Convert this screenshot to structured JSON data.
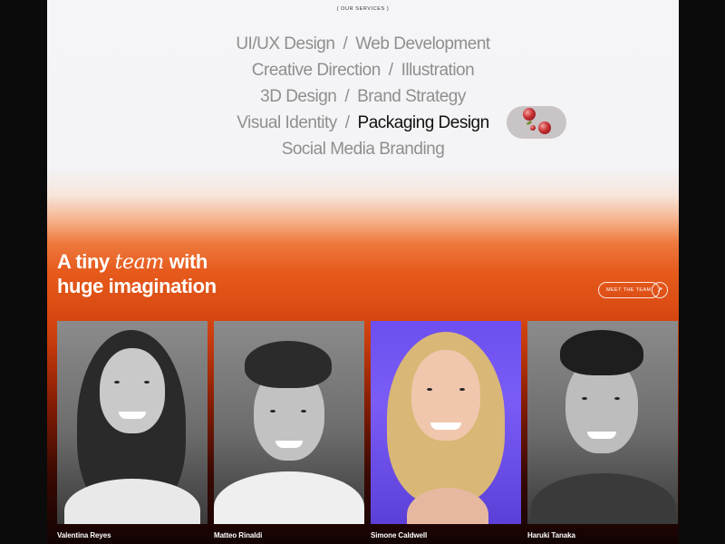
{
  "services": {
    "eyebrow": "{ OUR SERVICES }",
    "lines": [
      [
        "UI/UX Design",
        "Web Development"
      ],
      [
        "Creative Direction",
        "Illustration"
      ],
      [
        "3D Design",
        "Brand Strategy"
      ],
      [
        "Visual Identity",
        "Packaging Design"
      ],
      [
        "Social Media Branding"
      ]
    ],
    "separator": "/",
    "active": "Packaging Design"
  },
  "team_section": {
    "headline_part1": "A tiny ",
    "headline_em": "team",
    "headline_part2": " with",
    "headline_line2": "huge imagination",
    "cta_label": "MEET THE TEAM",
    "cta_icon": "arrow-up-right-icon"
  },
  "team": [
    {
      "name": "Valentina Reyes",
      "photo": "grayscale"
    },
    {
      "name": "Matteo Rinaldi",
      "photo": "grayscale"
    },
    {
      "name": "Simone Caldwell",
      "photo": "color"
    },
    {
      "name": "Haruki Tanaka",
      "photo": "grayscale"
    }
  ],
  "colors": {
    "accent_orange": "#e65a1c",
    "page_light": "#f5f4f6",
    "active_text": "#111111",
    "muted_text": "#8f8f8f"
  }
}
